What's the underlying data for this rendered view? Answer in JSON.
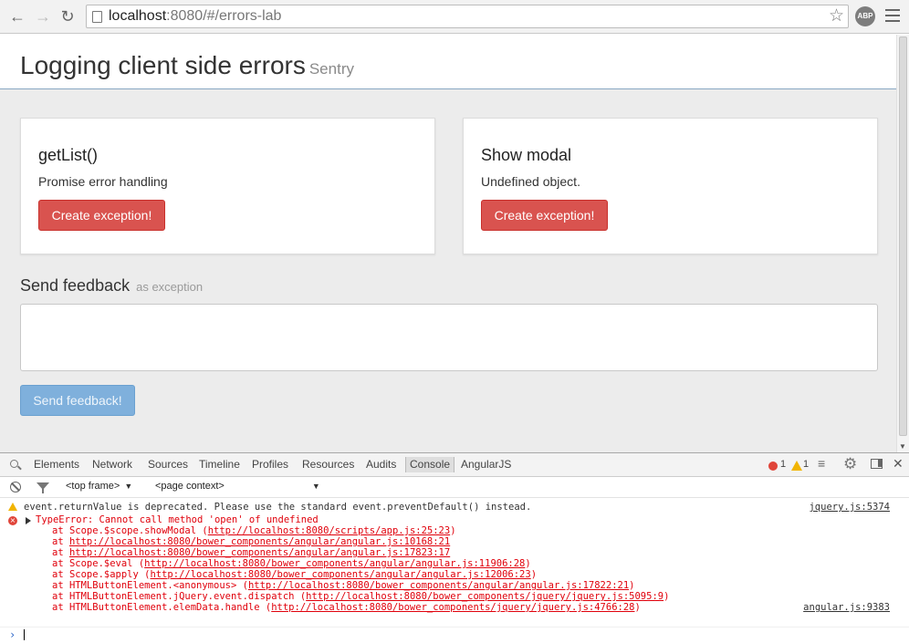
{
  "browser": {
    "url_host": "localhost",
    "url_rest": ":8080/#/errors-lab",
    "adblock_label": "ABP"
  },
  "page": {
    "title": "Logging client side errors",
    "subtitle": "Sentry",
    "cards": [
      {
        "title": "getList()",
        "description": "Promise error handling",
        "button": "Create exception!"
      },
      {
        "title": "Show modal",
        "description": "Undefined object.",
        "button": "Create exception!"
      }
    ],
    "feedback": {
      "title": "Send feedback",
      "subtitle": "as exception",
      "value": "",
      "button": "Send feedback!"
    }
  },
  "devtools": {
    "tabs": [
      "Elements",
      "Network",
      "Sources",
      "Timeline",
      "Profiles",
      "Resources",
      "Audits",
      "Console",
      "AngularJS"
    ],
    "active_tab": "Console",
    "error_count": "1",
    "warning_count": "1",
    "frame_select": "<top frame>",
    "context_select": "<page context>",
    "console": {
      "warning": {
        "text": "event.returnValue is deprecated. Please use the standard event.preventDefault() instead.",
        "source": "jquery.js:5374"
      },
      "error": {
        "message": "TypeError: Cannot call method 'open' of undefined",
        "source": "angular.js:9383",
        "stack": [
          {
            "prefix": "at Scope.$scope.showModal (",
            "link": "http://localhost:8080/scripts/app.js:25:23",
            "suffix": ")"
          },
          {
            "prefix": "at ",
            "link": "http://localhost:8080/bower_components/angular/angular.js:10168:21",
            "suffix": ""
          },
          {
            "prefix": "at ",
            "link": "http://localhost:8080/bower_components/angular/angular.js:17823:17",
            "suffix": ""
          },
          {
            "prefix": "at Scope.$eval (",
            "link": "http://localhost:8080/bower_components/angular/angular.js:11906:28",
            "suffix": ")"
          },
          {
            "prefix": "at Scope.$apply (",
            "link": "http://localhost:8080/bower_components/angular/angular.js:12006:23",
            "suffix": ")"
          },
          {
            "prefix": "at HTMLButtonElement.<anonymous> (",
            "link": "http://localhost:8080/bower_components/angular/angular.js:17822:21",
            "suffix": ")"
          },
          {
            "prefix": "at HTMLButtonElement.jQuery.event.dispatch (",
            "link": "http://localhost:8080/bower_components/jquery/jquery.js:5095:9",
            "suffix": ")"
          },
          {
            "prefix": "at HTMLButtonElement.elemData.handle (",
            "link": "http://localhost:8080/bower_components/jquery/jquery.js:4766:28",
            "suffix": ")"
          }
        ]
      }
    }
  }
}
